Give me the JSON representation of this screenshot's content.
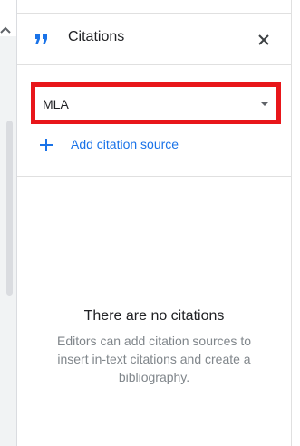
{
  "panel": {
    "title": "Citations",
    "close_label": "close"
  },
  "style_selector": {
    "value": "MLA",
    "highlight_color": "#e8161a"
  },
  "add_source": {
    "label": "Add citation source"
  },
  "empty_state": {
    "title": "There are no citations",
    "description": "Editors can add citation sources to insert in-text citations and create a bibliography."
  },
  "colors": {
    "accent": "#1a73e8",
    "text_primary": "#202124",
    "text_secondary": "#80868b"
  },
  "icons": {
    "header": "quote-icon",
    "close": "close-icon",
    "dropdown": "caret-down-icon",
    "add": "plus-icon",
    "left_chevron": "chevron-up-icon"
  }
}
